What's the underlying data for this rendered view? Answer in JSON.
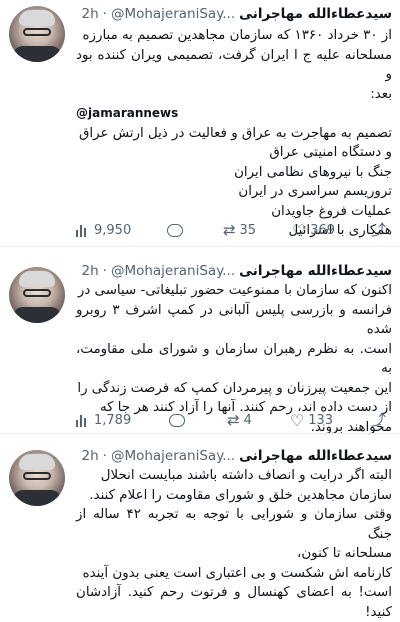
{
  "tweets": [
    {
      "name": "سیدعطاءالله مهاجرانی",
      "handle": "@MohajeraniSay...",
      "dot": "·",
      "time": "2h",
      "lines": [
        "از ۳۰ خرداد ۱۳۶۰ که سازمان مجاهدین تصمیم به مبارزه",
        "مسلحانه علیه ج ا ایران گرفت، تصمیمی ویران کننده بود و",
        "بعد:",
        "@jamarannews",
        "تصمیم به مهاجرت به عراق و فعالیت در ذیل ارتش عراق",
        "و دستگاه امنیتی عراق",
        "جنگ با نیروهای نظامی ایران",
        "تروریسم سراسری در ایران",
        "عملیات فروغ جاویدان",
        "همکاری با اسرائیل"
      ],
      "views": "9,950",
      "replies": "",
      "retweets": "35",
      "likes": "369"
    },
    {
      "name": "سیدعطاءالله مهاجرانی",
      "handle": "@MohajeraniSay...",
      "dot": "·",
      "time": "2h",
      "lines": [
        "اکنون که سازمان با ممنوعیت حضور تبلیغاتی- سیاسی در",
        "فرانسه و بازرسی پلیس آلبانی در کمپ اشرف ۳ روبرو شده",
        "است. به نظرم رهبران سازمان و شورای ملی مقاومت، به",
        "این جمعیت پیرزنان و پیرمردان کمپ که فرصت زندگی را",
        "از دست داده اند، رحم کنند. آنها را آزاد کنند هر جا که",
        "مخواهند بروند."
      ],
      "views": "1,789",
      "replies": "",
      "retweets": "4",
      "likes": "133"
    },
    {
      "name": "سیدعطاءالله مهاجرانی",
      "handle": "@MohajeraniSay...",
      "dot": "·",
      "time": "2h",
      "lines": [
        "البته اگر درایت و انصاف داشته باشند مبایست انحلال",
        "سازمان مجاهدین خلق و شورای مقاومت را اعلام کنند.",
        "وقتی سازمان و شورایی با توجه به تجربه ۴۲ ساله از جنگ",
        "مسلحانه تا کنون،",
        "کارنامه اش شکست و بی اعتباری است یعنی بدون آینده",
        "است! به اعضای کهنسال و فرتوت رحم کنید. آزادشان کنید!"
      ]
    }
  ]
}
